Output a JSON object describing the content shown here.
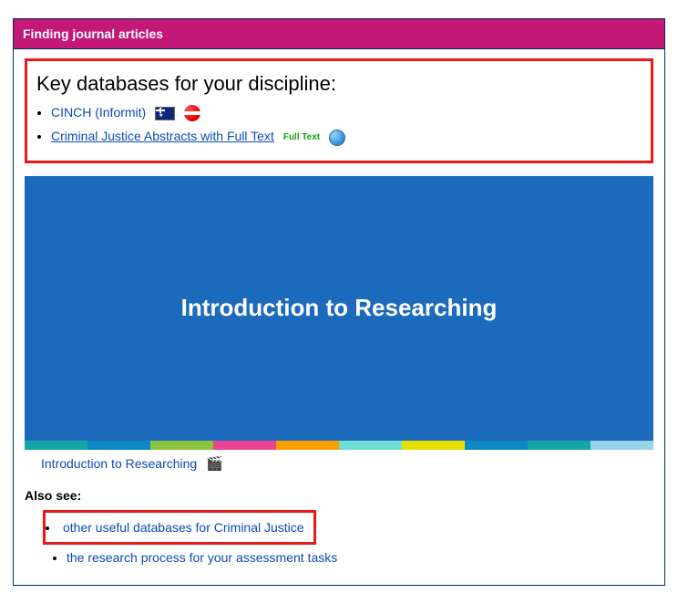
{
  "panel": {
    "header": "Finding journal articles"
  },
  "keySection": {
    "heading": "Key databases for your discipline:",
    "items": [
      {
        "label": "CINCH (Informit)"
      },
      {
        "label": "Criminal Justice Abstracts with Full Text"
      }
    ],
    "fullTextBadge": "Full\nText"
  },
  "video": {
    "overlayTitle": "Introduction to Researching",
    "linkLabel": "Introduction to Researching"
  },
  "alsoSee": {
    "heading": "Also see:",
    "items": [
      {
        "label": "other useful databases for Criminal Justice"
      },
      {
        "label": "the research process for your assessment tasks"
      }
    ]
  }
}
